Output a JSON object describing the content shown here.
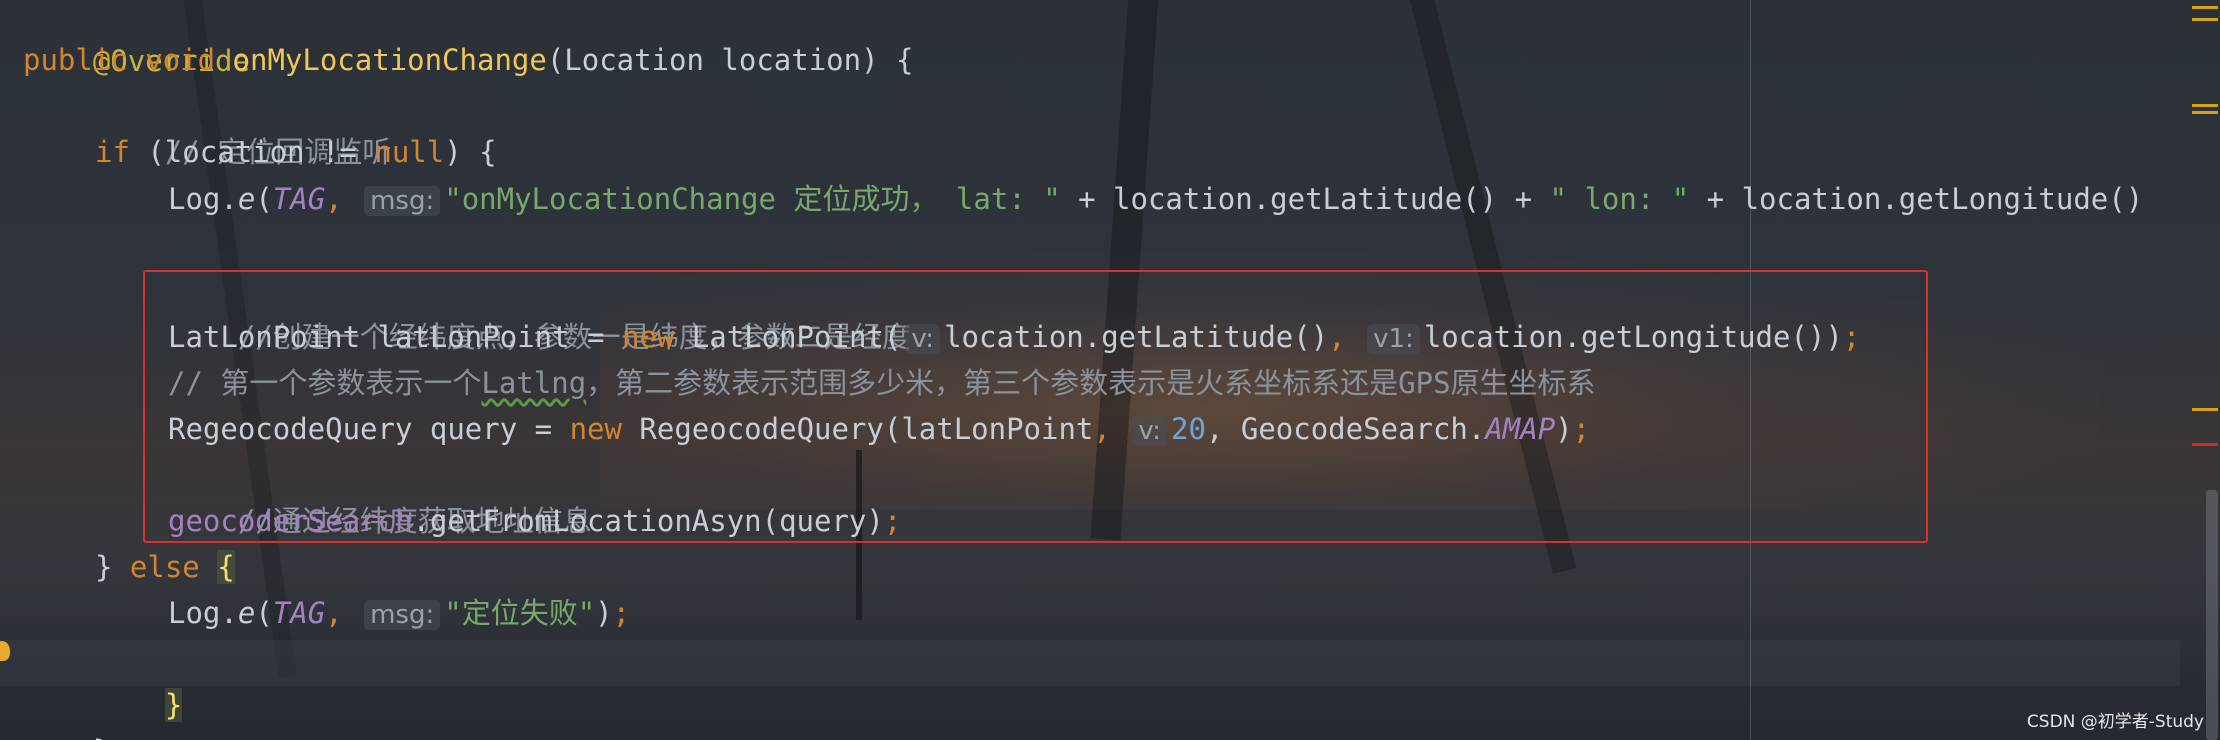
{
  "code": {
    "line1": {
      "annotation": "@Override"
    },
    "line2": {
      "kw1": "public",
      "kw2": "void",
      "method": "onMyLocationChange",
      "params": "(Location location) {"
    },
    "line3": {
      "comment": "// 定位回调监听"
    },
    "line4": {
      "kw": "if",
      "t1": " (location != ",
      "nullkw": "null",
      "t2": ") {"
    },
    "line5": {
      "t1": "Log.",
      "fn": "e",
      "t2": "(",
      "tag": "TAG",
      "comma": ",",
      "hint": "msg:",
      "str1": "\"onMyLocationChange 定位成功， lat: \"",
      "t3": " + location.getLatitude() + ",
      "str2": "\" lon: \"",
      "t4": " + location.getLongitude()"
    },
    "line7": {
      "comment": "//创建一个经纬度点，参数一是纬度，参数二是经度"
    },
    "line8": {
      "t1": "LatLonPoint latLonPoint = ",
      "newkw": "new",
      "t2": " LatLonPoint(",
      "hint1": "v:",
      "t3": "location.getLatitude()",
      "comma": ",",
      "hint2": "v1:",
      "t4": "location.getLongitude())",
      "semi": ";"
    },
    "line9": {
      "c1": "// 第一个参数表示一个",
      "c2": "Latlng",
      "c3": "，第二参数表示范围多少米，第三个参数表示是火系坐标系还是GPS原生坐标系"
    },
    "line10": {
      "t1": "RegeocodeQuery query = ",
      "newkw": "new",
      "t2": " RegeocodeQuery(latLonPoint",
      "comma": ",",
      "hint": "v:",
      "num": "20",
      "t3": ", GeocodeSearch.",
      "field": "AMAP",
      "t4": ")",
      "semi": ";"
    },
    "line11": {
      "comment": "//通过经纬度获取地址信息"
    },
    "line12": {
      "field": "geocoderSearch",
      "t1": ".getFromLocationAsyn(query)",
      "semi": ";"
    },
    "line13": {
      "t1": "} ",
      "kw": "else",
      "brace": "{"
    },
    "line14": {
      "t1": "Log.",
      "fn": "e",
      "t2": "(",
      "tag": "TAG",
      "comma": ",",
      "hint": "msg:",
      "str": "\"定位失败\"",
      "t3": ")",
      "semi": ";"
    },
    "line15": {
      "brace": "}"
    },
    "line16": {
      "brace": "}"
    }
  },
  "watermark": "CSDN @初学者-Study",
  "colors": {
    "keyword": "#d3842f",
    "method": "#f0c85a",
    "comment": "#8c929c",
    "string": "#79a86b",
    "static_field": "#a482c2",
    "number": "#6aa6d8",
    "highlight_box": "#d9302c"
  }
}
